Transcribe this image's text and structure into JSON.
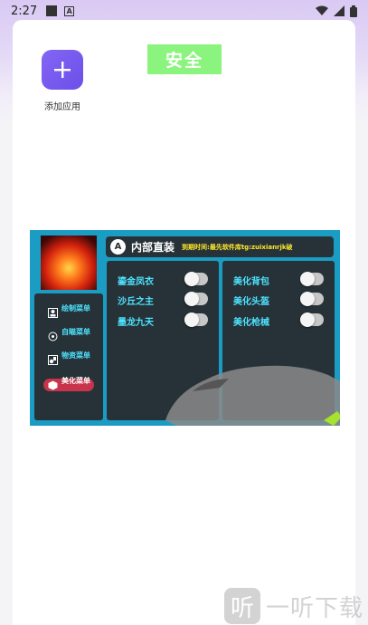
{
  "status_bar": {
    "time": "2:27"
  },
  "launcher": {
    "add_app_label": "添加应用",
    "safe_badge": "安全",
    "accent_color": "#7c5cf4"
  },
  "mod_menu": {
    "logo_letter": "A",
    "title": "内部直装",
    "expire_text": "到期时间:最先软件库tg:zuixianrjk破",
    "side_menu": [
      {
        "icon": "person-icon",
        "label": "绘制菜单"
      },
      {
        "icon": "target-icon",
        "label": "自瞄菜单"
      },
      {
        "icon": "supply-icon",
        "label": "物资菜单"
      },
      {
        "icon": "cube-icon",
        "label": "美化菜单",
        "active": true
      }
    ],
    "left_toggles": [
      {
        "label": "鎏金凤衣",
        "on": false
      },
      {
        "label": "沙丘之主",
        "on": false
      },
      {
        "label": "墨龙九天",
        "on": false
      }
    ],
    "right_toggles": [
      {
        "label": "美化背包",
        "on": false
      },
      {
        "label": "美化头盔",
        "on": false
      },
      {
        "label": "美化枪械",
        "on": false
      }
    ]
  },
  "watermark": {
    "glyph": "听",
    "text": "一听下载"
  }
}
